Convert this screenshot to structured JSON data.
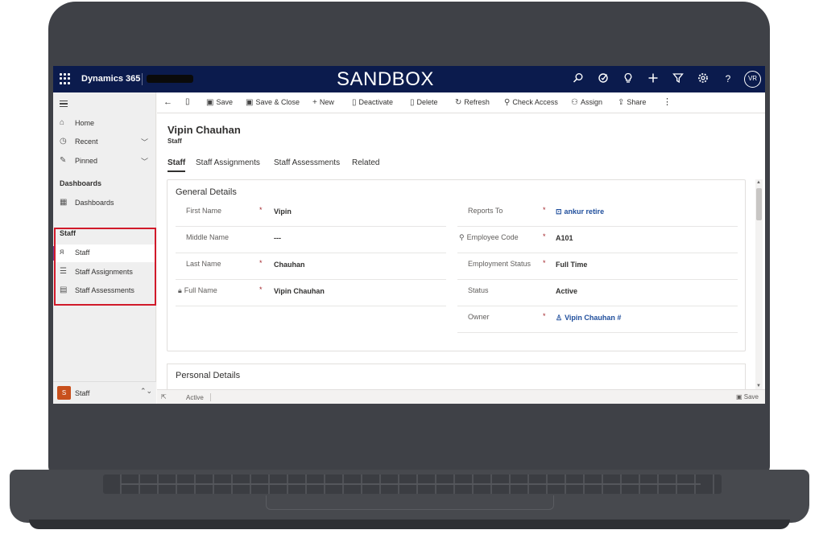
{
  "app": {
    "brand": "Dynamics 365",
    "environment_banner": "SANDBOX",
    "user_initials": "VR"
  },
  "topbar_icons": [
    "search-icon",
    "task-flow-icon",
    "lightbulb-icon",
    "plus-icon",
    "filter-icon",
    "settings-icon",
    "help-icon"
  ],
  "sidebar": {
    "home": "Home",
    "recent": "Recent",
    "pinned": "Pinned",
    "dashboards_group": "Dashboards",
    "dashboards": "Dashboards",
    "staff_group": "Staff",
    "staff": "Staff",
    "staff_assignments": "Staff Assignments",
    "staff_assessments": "Staff Assessments",
    "area": {
      "badge": "S",
      "label": "Staff"
    }
  },
  "commands": {
    "save": "Save",
    "save_close": "Save & Close",
    "new": "New",
    "deactivate": "Deactivate",
    "delete": "Delete",
    "refresh": "Refresh",
    "check_access": "Check Access",
    "assign": "Assign",
    "share": "Share"
  },
  "record": {
    "title": "Vipin Chauhan",
    "entity": "Staff"
  },
  "tabs": [
    "Staff",
    "Staff Assignments",
    "Staff Assessments",
    "Related"
  ],
  "general": {
    "section_title": "General Details",
    "left": [
      {
        "label": "First Name",
        "required": "*",
        "value": "Vipin"
      },
      {
        "label": "Middle Name",
        "required": "",
        "value": "---"
      },
      {
        "label": "Last Name",
        "required": "*",
        "value": "Chauhan"
      },
      {
        "label": "Full Name",
        "required": "*",
        "value": "Vipin Chauhan"
      }
    ],
    "right": [
      {
        "label": "Reports To",
        "required": "*",
        "value": "ankur retire"
      },
      {
        "label": "Employee Code",
        "required": "*",
        "value": "A101"
      },
      {
        "label": "Employment Status",
        "required": "*",
        "value": "Full Time"
      },
      {
        "label": "Status",
        "required": "",
        "value": "Active"
      },
      {
        "label": "Owner",
        "required": "*",
        "value": "Vipin Chauhan #"
      }
    ]
  },
  "personal": {
    "section_title": "Personal Details"
  },
  "footer": {
    "status": "Active",
    "save": "Save"
  }
}
